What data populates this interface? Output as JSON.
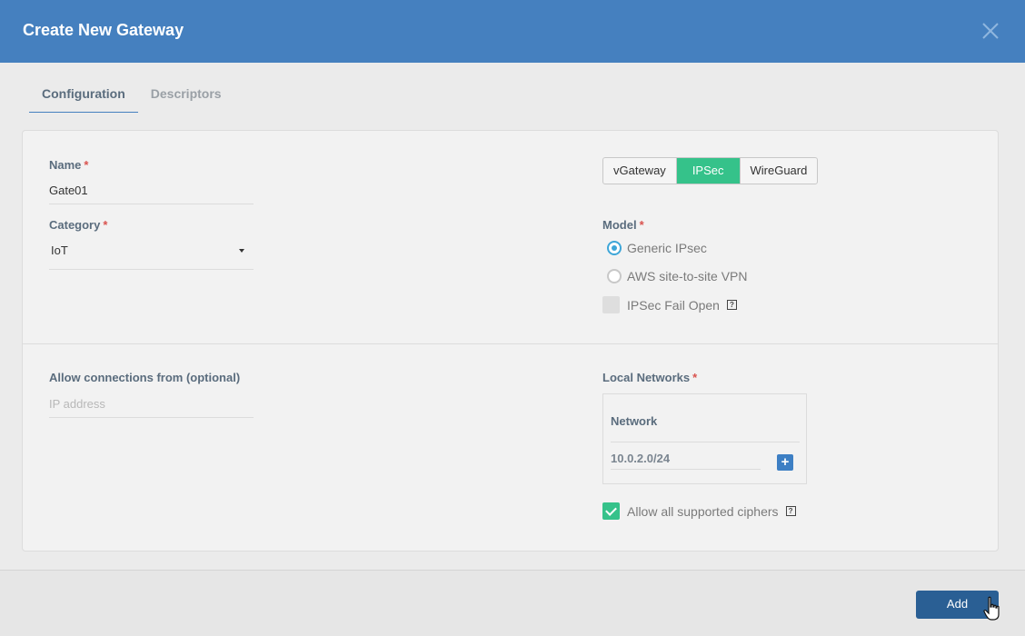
{
  "dialog": {
    "title": "Create New Gateway",
    "close_icon": "close-icon"
  },
  "tabs": [
    {
      "label": "Configuration",
      "active": true
    },
    {
      "label": "Descriptors",
      "active": false
    }
  ],
  "name": {
    "label": "Name",
    "required_mark": "*",
    "value": "Gate01"
  },
  "category": {
    "label": "Category",
    "required_mark": "*",
    "value": "IoT"
  },
  "gateway_type": {
    "options": [
      "vGateway",
      "IPSec",
      "WireGuard"
    ],
    "selected": "IPSec"
  },
  "model": {
    "label": "Model",
    "required_mark": "*",
    "options": [
      {
        "label": "Generic IPsec",
        "checked": true
      },
      {
        "label": "AWS site-to-site VPN",
        "checked": false
      }
    ],
    "fail_open": {
      "label": "IPSec Fail Open",
      "checked": false,
      "help": "?"
    }
  },
  "allow_connections": {
    "label": "Allow connections from (optional)",
    "placeholder": "IP address"
  },
  "local_networks": {
    "label": "Local Networks",
    "required_mark": "*",
    "column_header": "Network",
    "value": "10.0.2.0/24",
    "add_symbol": "+"
  },
  "ciphers": {
    "label": "Allow all supported ciphers",
    "checked": true,
    "help": "?"
  },
  "footer": {
    "add_label": "Add"
  },
  "colors": {
    "header": "#4580bf",
    "accent_green": "#35c28a",
    "primary_button": "#2a5f94",
    "required": "#d9534f"
  }
}
